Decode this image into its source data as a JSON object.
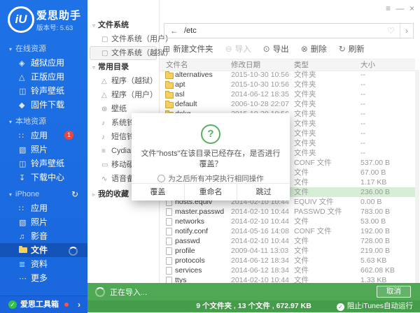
{
  "app": {
    "logo_text": "iU",
    "title": "爱思助手",
    "version_label": "版本号: 5.63"
  },
  "window_controls": {
    "menu": "≡",
    "minimize": "—",
    "close": "×"
  },
  "icons": {
    "jailbreak-apps": "◈",
    "genuine-apps": "△",
    "ringtone-wallpaper": "◫",
    "firmware-download": "◆",
    "apps-grid": "∷",
    "photos": "▧",
    "download-center": "↧",
    "media": "♫",
    "data-list": "≣",
    "more-dots": "⋯",
    "file-system": "▢",
    "program": "△",
    "wallpaper": "⊛",
    "bell": "♪",
    "cydia": "≡",
    "drive": "▭",
    "voice": "∿",
    "tri-down": "▾",
    "tri-down-h": "▿",
    "tri-right": "▹",
    "sync": "↻",
    "back": "←",
    "heart": "♡",
    "chevron": "›",
    "new-folder": "⊞",
    "import": "⊖",
    "export": "⊙",
    "delete": "⊗",
    "refresh": "↻",
    "check": "✓"
  },
  "sidebar": {
    "sections": [
      {
        "label": "在线资源",
        "sync_icon": false,
        "items": [
          {
            "name": "jailbreak-apps",
            "label": "越狱应用",
            "icon": "jailbreak-apps"
          },
          {
            "name": "genuine-apps",
            "label": "正版应用",
            "icon": "genuine-apps"
          },
          {
            "name": "ringtone-wallpaper",
            "label": "铃声壁纸",
            "icon": "ringtone-wallpaper"
          },
          {
            "name": "firmware-download",
            "label": "固件下载",
            "icon": "firmware-download"
          }
        ]
      },
      {
        "label": "本地资源",
        "sync_icon": false,
        "items": [
          {
            "name": "local-apps",
            "label": "应用",
            "icon": "apps-grid",
            "badge": "1"
          },
          {
            "name": "local-photos",
            "label": "照片",
            "icon": "photos"
          },
          {
            "name": "local-ringtone-wallpaper",
            "label": "铃声壁纸",
            "icon": "ringtone-wallpaper"
          },
          {
            "name": "download-center",
            "label": "下载中心",
            "icon": "download-center"
          }
        ]
      },
      {
        "label": "iPhone",
        "sync_icon": true,
        "items": [
          {
            "name": "iphone-apps",
            "label": "应用",
            "icon": "apps-grid"
          },
          {
            "name": "iphone-photos",
            "label": "照片",
            "icon": "photos"
          },
          {
            "name": "iphone-media",
            "label": "影音",
            "icon": "media"
          },
          {
            "name": "iphone-files",
            "label": "文件",
            "icon": "files-folder",
            "selected": true,
            "spinner": true
          },
          {
            "name": "iphone-data",
            "label": "资料",
            "icon": "data-list"
          },
          {
            "name": "iphone-more",
            "label": "更多",
            "icon": "more-dots"
          }
        ]
      }
    ],
    "toolbox": {
      "label": "爱思工具箱"
    }
  },
  "nav_panel": {
    "groups": [
      {
        "label": "文件系统",
        "collapsed": false,
        "items": [
          {
            "name": "fs-user",
            "label": "文件系统（用户）",
            "icon": "file-system"
          },
          {
            "name": "fs-jailbreak",
            "label": "文件系统（越狱）",
            "icon": "file-system",
            "selected": true
          }
        ]
      },
      {
        "label": "常用目录",
        "collapsed": false,
        "items": [
          {
            "name": "program-jailbreak",
            "label": "程序（越狱）",
            "icon": "program"
          },
          {
            "name": "program-user",
            "label": "程序（用户）",
            "icon": "program"
          },
          {
            "name": "wallpaper",
            "label": "壁纸",
            "icon": "wallpaper"
          },
          {
            "name": "system-ringtone",
            "label": "系统铃声",
            "icon": "bell"
          },
          {
            "name": "sms-ringtone",
            "label": "短信铃声",
            "icon": "bell"
          },
          {
            "name": "cydia-install",
            "label": "Cydia安装目录",
            "icon": "cydia"
          },
          {
            "name": "external-drive",
            "label": "移动硬盘",
            "icon": "drive"
          },
          {
            "name": "voice-memo",
            "label": "语音备忘录",
            "icon": "voice"
          }
        ]
      },
      {
        "label": "我的收藏",
        "collapsed": true,
        "items": []
      }
    ]
  },
  "main": {
    "address_bar": {
      "path": "/etc"
    },
    "toolbar": {
      "buttons": [
        {
          "name": "new-folder",
          "label": "新建文件夹",
          "icon": "new-folder",
          "disabled": false
        },
        {
          "name": "import",
          "label": "导入",
          "icon": "import",
          "disabled": true
        },
        {
          "name": "export",
          "label": "导出",
          "icon": "export",
          "disabled": false
        },
        {
          "name": "delete",
          "label": "删除",
          "icon": "delete",
          "disabled": false
        },
        {
          "name": "refresh",
          "label": "刷新",
          "icon": "refresh",
          "disabled": false
        }
      ]
    },
    "file_table": {
      "columns": [
        "文件名",
        "修改日期",
        "类型",
        "大小"
      ],
      "rows": [
        {
          "name": "alternatives",
          "date": "2015-10-30 10:56",
          "type": "文件夹",
          "size": "--",
          "kind": "folder",
          "selected": false
        },
        {
          "name": "apt",
          "date": "2015-10-30 10:56",
          "type": "文件夹",
          "size": "--",
          "kind": "folder",
          "selected": false
        },
        {
          "name": "asl",
          "date": "2014-06-12 18:35",
          "type": "文件夹",
          "size": "--",
          "kind": "folder",
          "selected": false
        },
        {
          "name": "default",
          "date": "2006-10-28 22:07",
          "type": "文件夹",
          "size": "--",
          "kind": "folder",
          "selected": false
        },
        {
          "name": "dpkg",
          "date": "2015-10-30 10:56",
          "type": "文件夹",
          "size": "--",
          "kind": "folder",
          "selected": false
        },
        {
          "name": "",
          "date": "",
          "type": "文件夹",
          "size": "--",
          "kind": "folder",
          "selected": false
        },
        {
          "name": "",
          "date": "",
          "type": "文件夹",
          "size": "--",
          "kind": "folder",
          "selected": false
        },
        {
          "name": "",
          "date": "",
          "type": "文件夹",
          "size": "--",
          "kind": "folder",
          "selected": false
        },
        {
          "name": "",
          "date": "",
          "type": "文件夹",
          "size": "--",
          "kind": "folder",
          "selected": false
        },
        {
          "name": "",
          "date": "",
          "type": "CONF 文件",
          "size": "537.00 B",
          "kind": "file",
          "selected": false
        },
        {
          "name": "",
          "date": "",
          "type": "文件",
          "size": "67.00 B",
          "kind": "file",
          "selected": false
        },
        {
          "name": "",
          "date": "",
          "type": "文件",
          "size": "1.17 KB",
          "kind": "file",
          "selected": false
        },
        {
          "name": "hosts",
          "date": "",
          "type": "文件",
          "size": "236.00 B",
          "kind": "file",
          "selected": true
        },
        {
          "name": "hosts.equiv",
          "date": "2014-02-10 10:44",
          "type": "EQUIV 文件",
          "size": "0.00 B",
          "kind": "file",
          "selected": false
        },
        {
          "name": "master.passwd",
          "date": "2014-02-10 10:44",
          "type": "PASSWD 文件",
          "size": "783.00 B",
          "kind": "file",
          "selected": false
        },
        {
          "name": "networks",
          "date": "2014-02-10 10:44",
          "type": "文件",
          "size": "53.00 B",
          "kind": "file",
          "selected": false
        },
        {
          "name": "notify.conf",
          "date": "2014-05-16 14:08",
          "type": "CONF 文件",
          "size": "192.00 B",
          "kind": "file",
          "selected": false
        },
        {
          "name": "passwd",
          "date": "2014-02-10 10:44",
          "type": "文件",
          "size": "728.00 B",
          "kind": "file",
          "selected": false
        },
        {
          "name": "profile",
          "date": "2009-04-11 13:03",
          "type": "文件",
          "size": "219.00 B",
          "kind": "file",
          "selected": false
        },
        {
          "name": "protocols",
          "date": "2014-06-12 18:34",
          "type": "文件",
          "size": "5.63 KB",
          "kind": "file",
          "selected": false
        },
        {
          "name": "services",
          "date": "2014-06-12 18:34",
          "type": "文件",
          "size": "662.08 KB",
          "kind": "file",
          "selected": false
        },
        {
          "name": "ttys",
          "date": "2014-02-10 10:44",
          "type": "文件",
          "size": "1.33 KB",
          "kind": "file",
          "selected": false
        }
      ]
    }
  },
  "dialog": {
    "message_line1": "文件\"hosts\"在该目录已经存在，是否进行",
    "message_line2": "覆盖？",
    "option_label": "为之后所有冲突执行相同操作",
    "buttons": [
      "覆盖",
      "重命名",
      "跳过"
    ]
  },
  "progress": {
    "status": "正在导入...",
    "cancel_label": "取消"
  },
  "status_bar": {
    "summary": "9 个文件夹 , 13 个文件 , 672.97 KB",
    "right_label": "阻止iTunes自动运行"
  },
  "colors": {
    "sidebar_blue": "#1c6be0",
    "progress_green": "#4fa954",
    "status_green": "#459c4b",
    "badge_red": "#f4433c",
    "row_highlight": "#d7eed6",
    "folder_yellow": "#f5d060",
    "dialog_green": "#57b25b"
  }
}
